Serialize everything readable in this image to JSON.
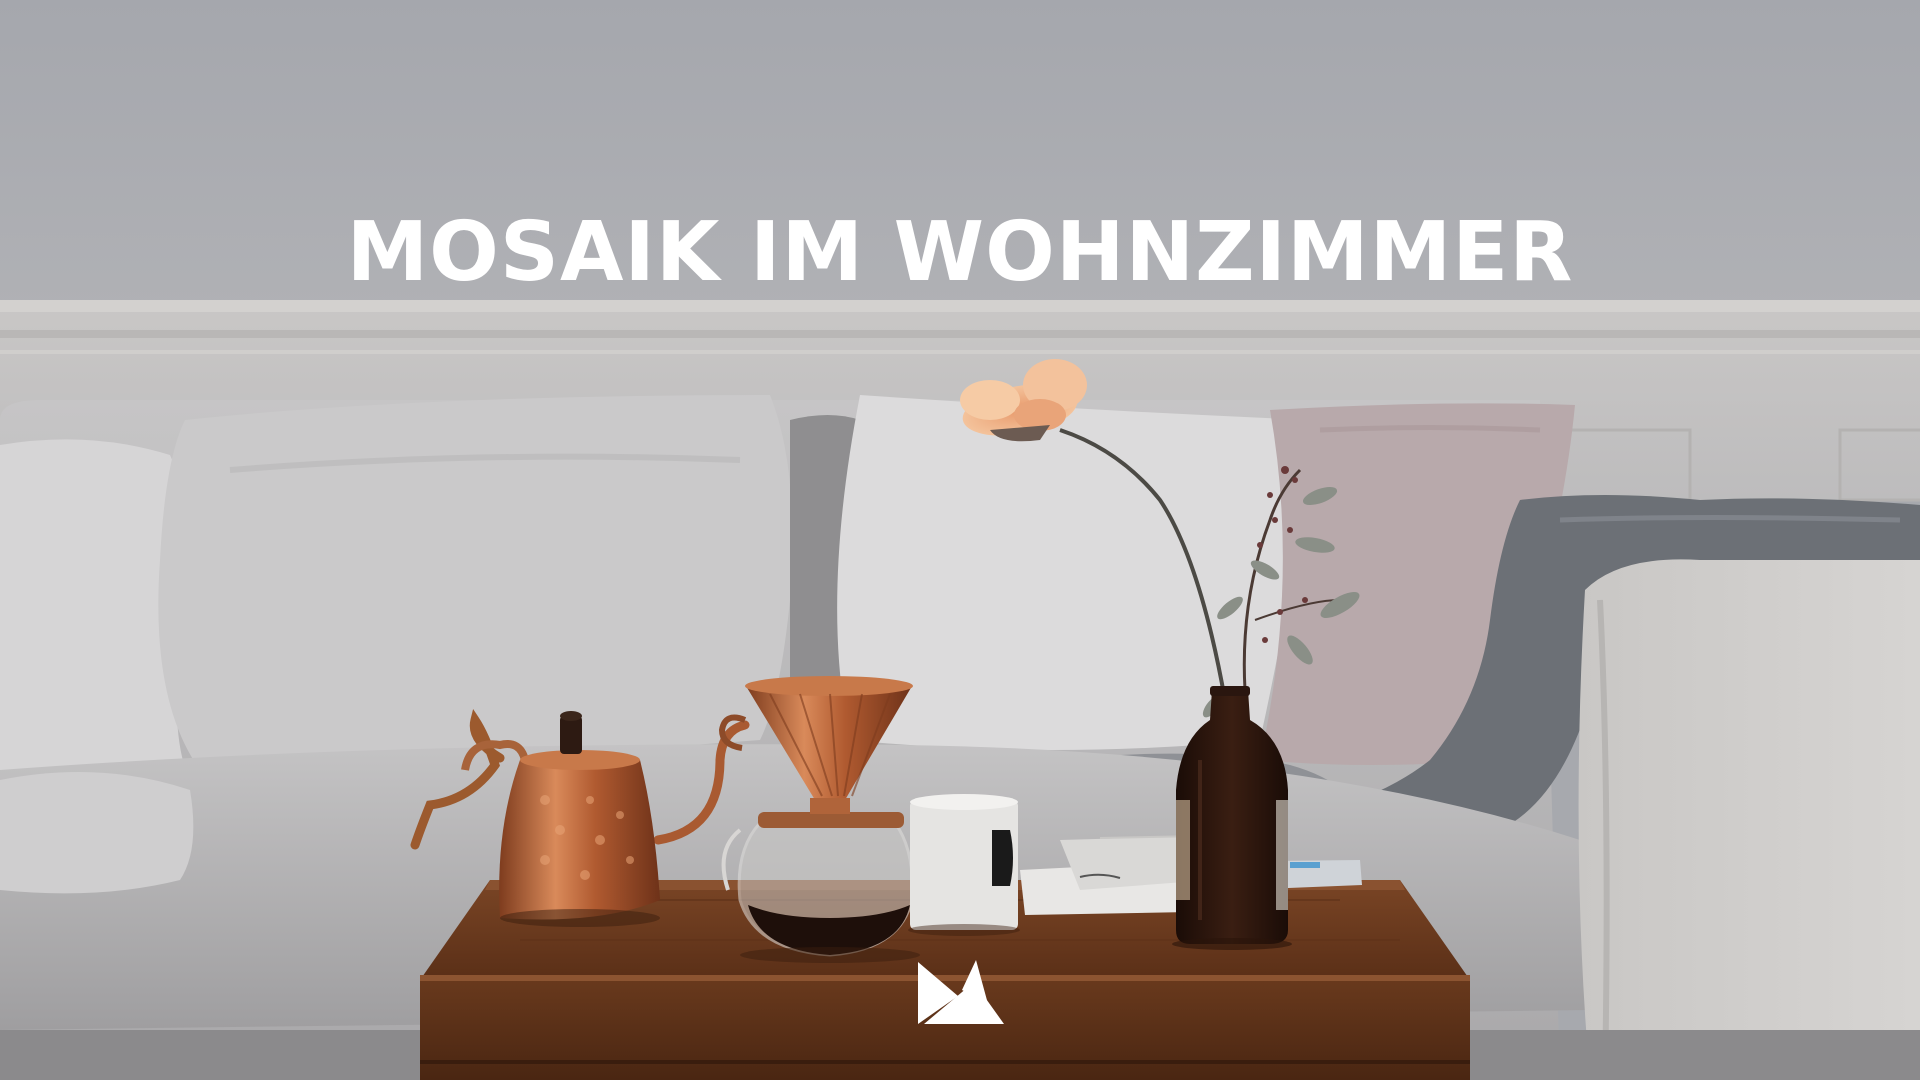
{
  "headline": "MOSAIK IM WOHNZIMMER",
  "logo": {
    "name": "mosaik-brand-logo",
    "color": "#ffffff"
  },
  "palette": {
    "wall": "#a8aab0",
    "wainscot": "#c9c7c5",
    "sofa": "#c8c6c5",
    "cushion_light": "#d9d8d9",
    "cushion_pink": "#b9a9ab",
    "blanket": "#6e7277",
    "table_wood": "#6b3a1c",
    "copper": "#b8643a",
    "flower": "#f0b891",
    "bottle": "#2a160f"
  },
  "objects": [
    "copper-kettle",
    "pour-over-dripper",
    "glass-carafe",
    "ceramic-mug",
    "open-notebook",
    "glass-bottle-vase",
    "peach-flower",
    "eucalyptus-sprig",
    "sofa",
    "cushions",
    "throw-blanket",
    "wooden-coffee-table"
  ]
}
